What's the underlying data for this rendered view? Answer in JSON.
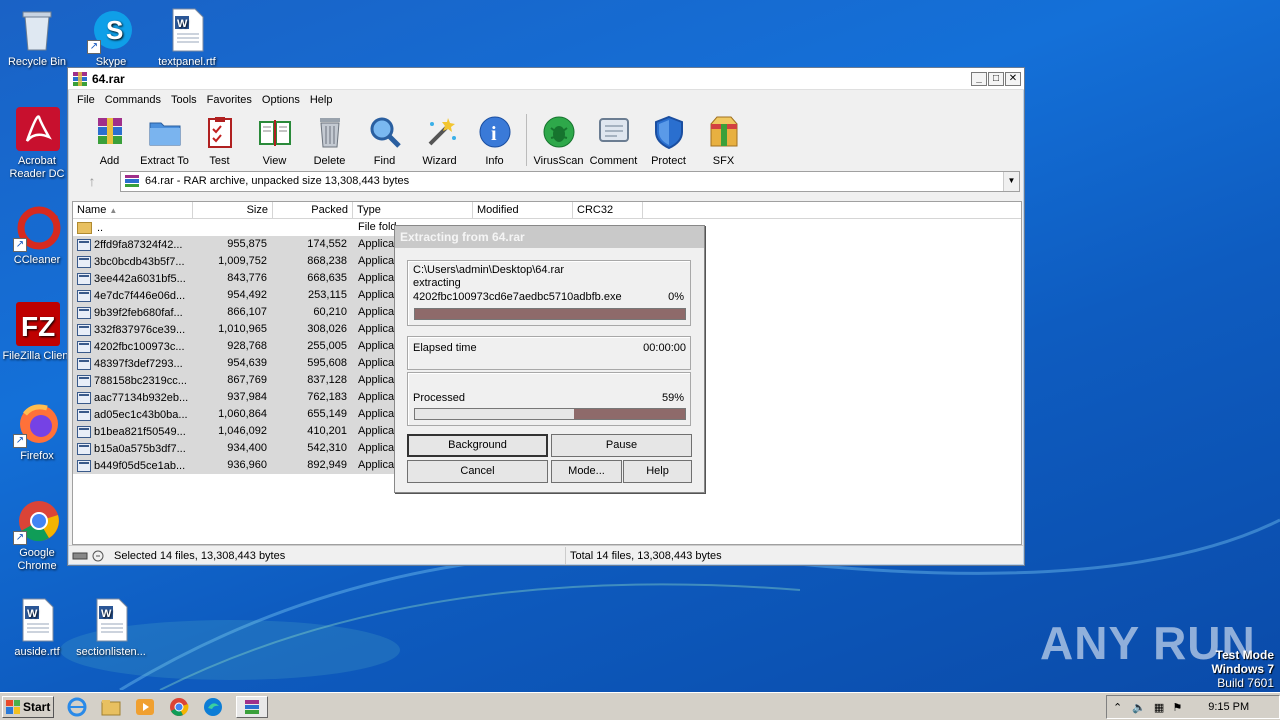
{
  "desktop": {
    "icons": [
      {
        "label": "Recycle Bin"
      },
      {
        "label": "Skype"
      },
      {
        "label": "textpanel.rtf"
      },
      {
        "label": "Acrobat Reader DC"
      },
      {
        "label": "CCleaner"
      },
      {
        "label": "FileZilla Client"
      },
      {
        "label": "Firefox"
      },
      {
        "label": "Google Chrome"
      },
      {
        "label": "auside.rtf"
      },
      {
        "label": "sectionlisten..."
      }
    ],
    "watermark": "ANY RUN",
    "test_mode": {
      "line1": "Test Mode",
      "line2": "Windows 7",
      "line3": "Build 7601"
    }
  },
  "window": {
    "title": "64.rar",
    "menu": [
      "File",
      "Commands",
      "Tools",
      "Favorites",
      "Options",
      "Help"
    ],
    "toolbar": [
      "Add",
      "Extract To",
      "Test",
      "View",
      "Delete",
      "Find",
      "Wizard",
      "Info",
      "VirusScan",
      "Comment",
      "Protect",
      "SFX"
    ],
    "address": "64.rar - RAR archive, unpacked size 13,308,443 bytes",
    "columns": [
      "Name",
      "Size",
      "Packed",
      "Type",
      "Modified",
      "CRC32"
    ],
    "parent_row": {
      "name": "..",
      "type": "File fold"
    },
    "rows": [
      {
        "name": "2ffd9fa87324f42...",
        "size": "955,875",
        "packed": "174,552",
        "type": "Applicat"
      },
      {
        "name": "3bc0bcdb43b5f7...",
        "size": "1,009,752",
        "packed": "868,238",
        "type": "Applicat"
      },
      {
        "name": "3ee442a6031bf5...",
        "size": "843,776",
        "packed": "668,635",
        "type": "Applicat"
      },
      {
        "name": "4e7dc7f446e06d...",
        "size": "954,492",
        "packed": "253,115",
        "type": "Applicat"
      },
      {
        "name": "9b39f2feb680faf...",
        "size": "866,107",
        "packed": "60,210",
        "type": "Applicat"
      },
      {
        "name": "332f837976ce39...",
        "size": "1,010,965",
        "packed": "308,026",
        "type": "Applicat"
      },
      {
        "name": "4202fbc100973c...",
        "size": "928,768",
        "packed": "255,005",
        "type": "Applicat"
      },
      {
        "name": "48397f3def7293...",
        "size": "954,639",
        "packed": "595,608",
        "type": "Applicat"
      },
      {
        "name": "788158bc2319cc...",
        "size": "867,769",
        "packed": "837,128",
        "type": "Applicat"
      },
      {
        "name": "aac77134b932eb...",
        "size": "937,984",
        "packed": "762,183",
        "type": "Applicat"
      },
      {
        "name": "ad05ec1c43b0ba...",
        "size": "1,060,864",
        "packed": "655,149",
        "type": "Applicat"
      },
      {
        "name": "b1bea821f50549...",
        "size": "1,046,092",
        "packed": "410,201",
        "type": "Applicat"
      },
      {
        "name": "b15a0a575b3df7...",
        "size": "934,400",
        "packed": "542,310",
        "type": "Applicat"
      },
      {
        "name": "b449f05d5ce1ab...",
        "size": "936,960",
        "packed": "892,949",
        "type": "Applicat"
      }
    ],
    "status_left": "Selected 14 files, 13,308,443 bytes",
    "status_right": "Total 14 files, 13,308,443 bytes"
  },
  "dialog": {
    "title": "Extracting from 64.rar",
    "path": "C:\\Users\\admin\\Desktop\\64.rar",
    "action": "extracting",
    "file": "4202fbc100973cd6e7aedbc5710adbfb.exe",
    "file_percent": "0%",
    "file_progress": 0,
    "elapsed_label": "Elapsed time",
    "elapsed_value": "00:00:00",
    "processed_label": "Processed",
    "processed_percent": "59%",
    "processed_progress": 0.59,
    "buttons": {
      "background": "Background",
      "pause": "Pause",
      "cancel": "Cancel",
      "mode": "Mode...",
      "help": "Help"
    }
  },
  "taskbar": {
    "start": "Start",
    "clock": "9:15 PM"
  }
}
